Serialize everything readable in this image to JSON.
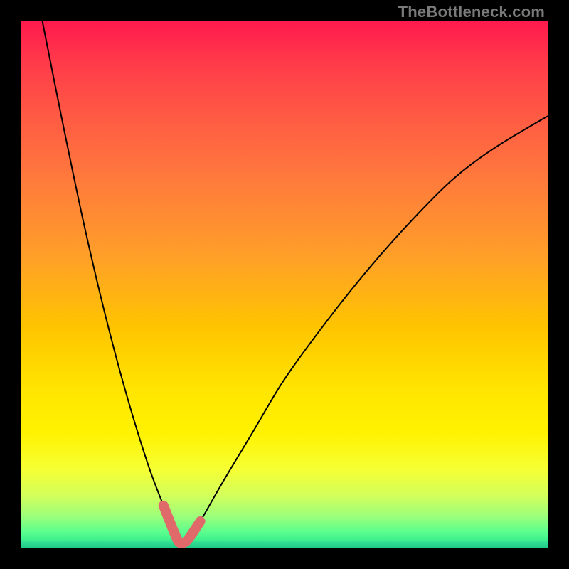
{
  "watermark": "TheBottleneck.com",
  "colors": {
    "pink_marker": "#e06a6a",
    "curve_stroke": "#000000",
    "frame_bg": "#000000",
    "gradient_top": "#ff1a4d",
    "gradient_bottom": "#23e08b"
  },
  "chart_data": {
    "type": "line",
    "title": "",
    "xlabel": "",
    "ylabel": "",
    "xlim": [
      0,
      100
    ],
    "ylim": [
      0,
      100
    ],
    "grid": false,
    "legend": false,
    "series": [
      {
        "name": "bottleneck-curve",
        "x": [
          4,
          8,
          12,
          16,
          20,
          24,
          27,
          29,
          30,
          31,
          32,
          34,
          38,
          44,
          50,
          58,
          66,
          74,
          82,
          90,
          100
        ],
        "y": [
          100,
          80,
          61,
          44,
          29,
          16,
          8,
          3,
          1,
          1,
          2,
          5,
          12,
          22,
          32,
          43,
          53,
          62,
          70,
          76,
          82
        ]
      }
    ],
    "annotations": [
      {
        "name": "optimal-range-marker",
        "kind": "highlight-segment",
        "x_range": [
          27,
          34
        ],
        "y_range": [
          1,
          8
        ],
        "color": "#e06a6a"
      }
    ],
    "minimum": {
      "x": 30.5,
      "y": 1
    }
  }
}
